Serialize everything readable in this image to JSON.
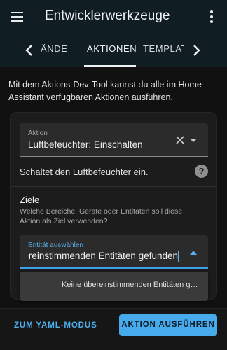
{
  "header": {
    "title": "Entwicklerwerkzeuge",
    "menu_icon": "hamburger-menu-icon",
    "overflow_icon": "kebab-menu-icon"
  },
  "tabs": {
    "items": [
      {
        "label": "ZUSTÄNDE",
        "visible_text": "ÄNDE"
      },
      {
        "label": "AKTIONEN",
        "active": true
      },
      {
        "label": "TEMPLAT"
      }
    ],
    "prev_icon": "chevron-left-icon",
    "next_icon": "chevron-right-icon"
  },
  "intro_text": "Mit dem Aktions-Dev-Tool kannst du alle im Home Assistant verfügbaren Aktionen ausführen.",
  "action_field": {
    "label": "Aktion",
    "value": "Luftbefeuchter: Einschalten"
  },
  "action_description": "Schaltet den Luftbefeuchter ein.",
  "targets": {
    "heading": "Ziele",
    "description": "Welche Bereiche, Geräte oder Entitäten soll diese Aktion als Ziel verwenden?",
    "entity_field": {
      "label": "Entität auswählen",
      "value": "übereinstimmenden Entitäten gefunden"
    },
    "suggestion": "Keine übereinstimmenden Entitäten gefunden"
  },
  "footer": {
    "yaml_button": "ZUM YAML-MODUS",
    "run_button": "AKTION AUSFÜHREN"
  },
  "colors": {
    "accent": "#46aaed",
    "topbar": "#101e24",
    "background": "#111111",
    "card": "#1c1c1c"
  }
}
